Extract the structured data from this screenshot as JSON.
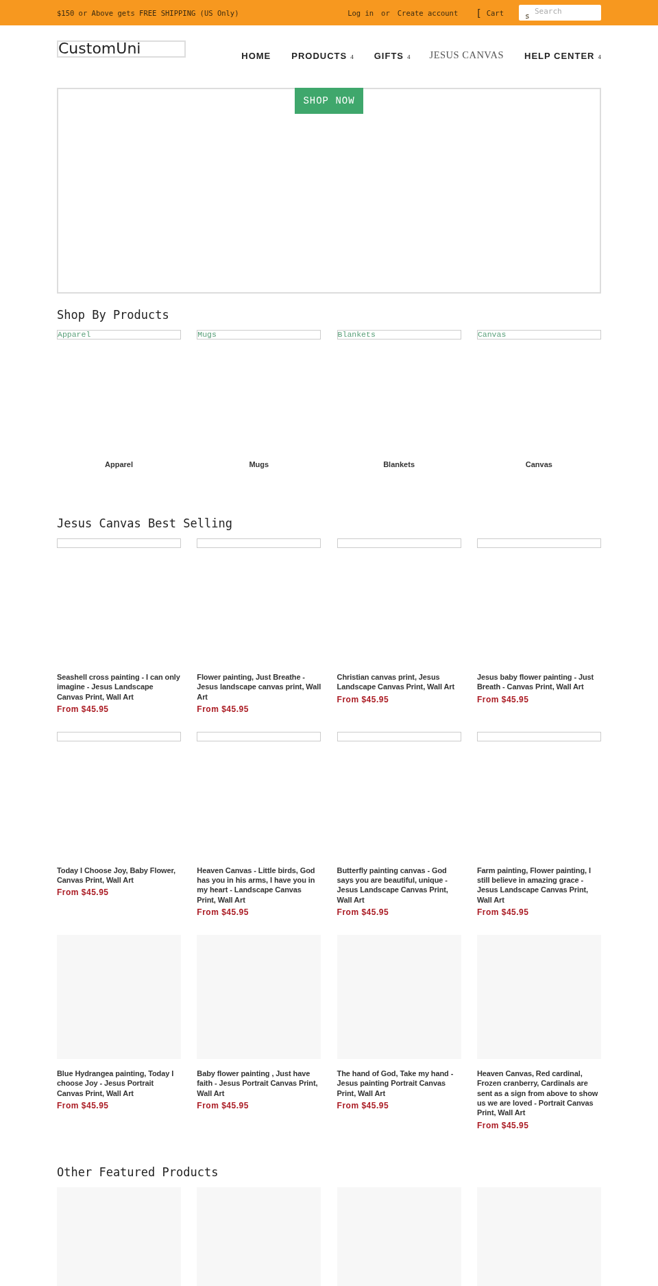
{
  "top_bar": {
    "promo": "$150 or Above gets FREE SHIPPING (US Only)",
    "login": "Log in",
    "separator": "or",
    "create_account": "Create account",
    "cart_icon_glyph": "[",
    "cart": "Cart",
    "search": {
      "icon_glyph": "s",
      "placeholder": "Search"
    }
  },
  "header": {
    "logo": "CustomUni",
    "nav": [
      {
        "label": "HOME",
        "kind": "menu"
      },
      {
        "label": "PRODUCTS",
        "kind": "menu",
        "caret": "4"
      },
      {
        "label": "GIFTS",
        "kind": "menu",
        "caret": "4"
      },
      {
        "label": "JESUS CANVAS",
        "kind": "plain"
      },
      {
        "label": "HELP CENTER",
        "kind": "menu",
        "caret": "4"
      }
    ]
  },
  "hero": {
    "button": "SHOP NOW"
  },
  "shop_by_products": {
    "title": "Shop By Products",
    "categories": [
      {
        "alt": "Apparel",
        "label": "Apparel"
      },
      {
        "alt": "Mugs",
        "label": "Mugs"
      },
      {
        "alt": "Blankets",
        "label": "Blankets"
      },
      {
        "alt": "Canvas",
        "label": "Canvas"
      }
    ]
  },
  "best_selling": {
    "title": "Jesus Canvas Best Selling",
    "products": [
      {
        "kind": "broken",
        "title": "Seashell cross painting - I can only imagine - Jesus Landscape Canvas Print, Wall Art",
        "price": "From $45.95"
      },
      {
        "kind": "broken",
        "title": "Flower painting, Just Breathe - Jesus landscape canvas print, Wall Art",
        "price": "From $45.95"
      },
      {
        "kind": "broken",
        "title": "Christian canvas print, Jesus Landscape Canvas Print, Wall Art",
        "price": "From $45.95"
      },
      {
        "kind": "broken",
        "title": "Jesus baby flower painting - Just Breath - Canvas Print, Wall Art",
        "price": "From $45.95"
      },
      {
        "kind": "broken",
        "title": "Today I Choose Joy, Baby Flower, Canvas Print, Wall Art",
        "price": "From $45.95"
      },
      {
        "kind": "broken",
        "title": "Heaven Canvas - Little birds, God has you in his arms, I have you in my heart - Landscape Canvas Print, Wall Art",
        "price": "From $45.95"
      },
      {
        "kind": "broken",
        "title": "Butterfly painting canvas - God says you are beautiful, unique - Jesus Landscape Canvas Print, Wall Art",
        "price": "From $45.95"
      },
      {
        "kind": "broken",
        "title": "Farm painting, Flower painting, I still believe in amazing grace - Jesus Landscape Canvas Print, Wall Art",
        "price": "From $45.95"
      },
      {
        "kind": "placeholder",
        "title": "Blue Hydrangea painting, Today I choose Joy - Jesus Portrait Canvas Print, Wall Art",
        "price": "From $45.95"
      },
      {
        "kind": "placeholder",
        "title": "Baby flower painting , Just have faith - Jesus Portrait Canvas Print, Wall Art",
        "price": "From $45.95"
      },
      {
        "kind": "placeholder",
        "title": "The hand of God, Take my hand - Jesus painting Portrait Canvas Print, Wall Art",
        "price": "From $45.95"
      },
      {
        "kind": "placeholder",
        "title": "Heaven Canvas, Red cardinal, Frozen cranberry, Cardinals are sent as a sign from above to show us we are loved - Portrait Canvas Print, Wall Art",
        "price": "From $45.95"
      }
    ]
  },
  "other_featured": {
    "title": "Other Featured Products",
    "products": [
      {
        "kind": "placeholder"
      },
      {
        "kind": "placeholder"
      },
      {
        "kind": "placeholder"
      },
      {
        "kind": "placeholder"
      }
    ]
  }
}
